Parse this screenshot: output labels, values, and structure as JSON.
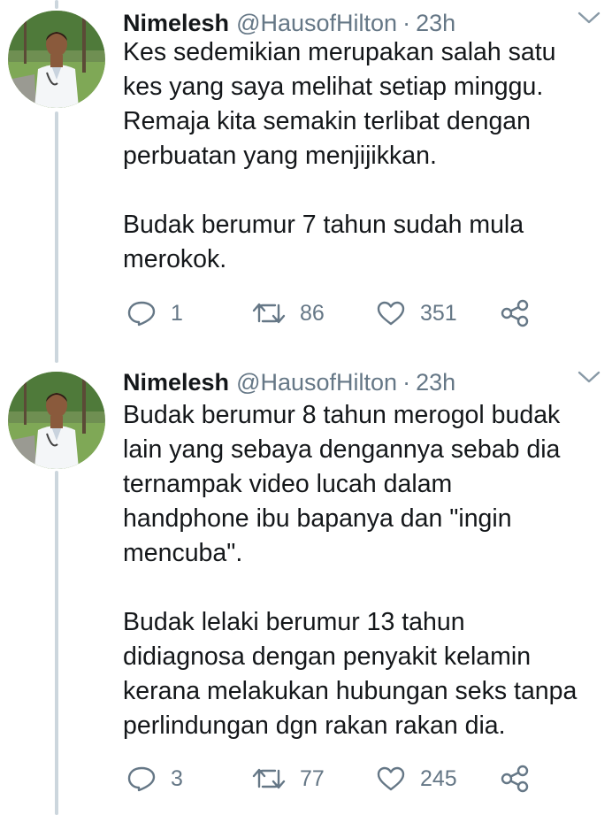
{
  "tweets": [
    {
      "author": {
        "name": "Nimelesh",
        "handle": "@HausofHilton",
        "separator": "·",
        "time": "23h"
      },
      "text_lines": [
        "Kes sedemikian merupakan salah satu",
        "kes yang saya melihat setiap minggu.",
        "Remaja kita semakin terlibat dengan",
        "perbuatan yang menjijikkan.",
        "",
        "Budak berumur 7 tahun sudah mula",
        "merokok."
      ],
      "stats": {
        "replies": "1",
        "retweets": "86",
        "likes": "351"
      }
    },
    {
      "author": {
        "name": "Nimelesh",
        "handle": "@HausofHilton",
        "separator": "·",
        "time": "23h"
      },
      "text_lines": [
        "Budak berumur 8 tahun merogol budak",
        "lain yang sebaya dengannya sebab dia",
        "ternampak video lucah dalam",
        "handphone ibu bapanya dan \"ingin",
        "mencuba\".",
        "",
        "Budak lelaki berumur 13 tahun",
        "didiagnosa dengan penyakit kelamin",
        "kerana melakukan hubungan seks tanpa",
        "perlindungan dgn rakan rakan dia."
      ],
      "stats": {
        "replies": "3",
        "retweets": "77",
        "likes": "245"
      }
    }
  ],
  "icons": {
    "reply": "reply-icon",
    "retweet": "retweet-icon",
    "like": "heart-icon",
    "share": "share-icon",
    "menu": "chevron-down-icon"
  },
  "colors": {
    "text": "#14171a",
    "secondary": "#657786",
    "thread_line": "#ccd6dd"
  }
}
